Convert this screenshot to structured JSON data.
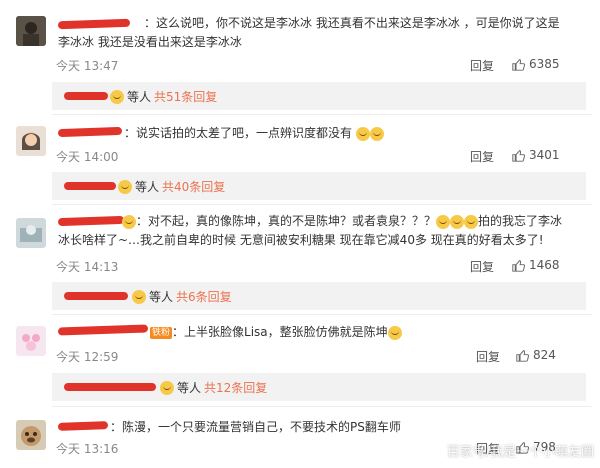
{
  "colors": {
    "accent": "#eb7350",
    "redact": "#e0342a",
    "reply_bg": "#f2f2f2"
  },
  "comments": [
    {
      "text": "：这么说吧，你不说这是李冰冰 我还真看不出来这是李冰冰 ，可是你说了这是李冰冰 我还是没看出来这是李冰冰",
      "time": "今天 13:47",
      "reply_label": "回复",
      "likes": "6385",
      "reply_summary": {
        "who": "等人",
        "count": "共51条回复"
      }
    },
    {
      "text": "：说实话拍的太差了吧，一点辨识度都没有",
      "time": "今天 14:00",
      "reply_label": "回复",
      "likes": "3401",
      "reply_summary": {
        "who": "等人",
        "count": "共40条回复"
      }
    },
    {
      "text": "：对不起，真的像陈坤，真的不是陈坤？或者袁泉？？？",
      "text2": "拍的我忘了李冰冰长啥样了~…我之前自卑的时候 无意间被安利糖果 现在靠它减40多 现在真的好看太多了!",
      "time": "今天 14:13",
      "reply_label": "回复",
      "likes": "1468",
      "reply_summary": {
        "who": "等人",
        "count": "共6条回复"
      }
    },
    {
      "badge": "铁粉",
      "text": "：上半张脸像Lisa，整张脸仿佛就是陈坤",
      "time": "今天 12:59",
      "reply_label": "回复",
      "likes": "824",
      "reply_summary": {
        "who": "等人",
        "count": "共12条回复"
      }
    },
    {
      "text": "：陈漫，一个只要流量营销自己，不要技术的PS翻车师",
      "time": "今天 13:16",
      "reply_label": "回复",
      "likes": "798"
    }
  ],
  "icons": {
    "like": "thumbs-up-icon",
    "emoji": "emoji-icon",
    "avatar": "avatar"
  },
  "watermark": "百家号/我是一个小萌友圈"
}
